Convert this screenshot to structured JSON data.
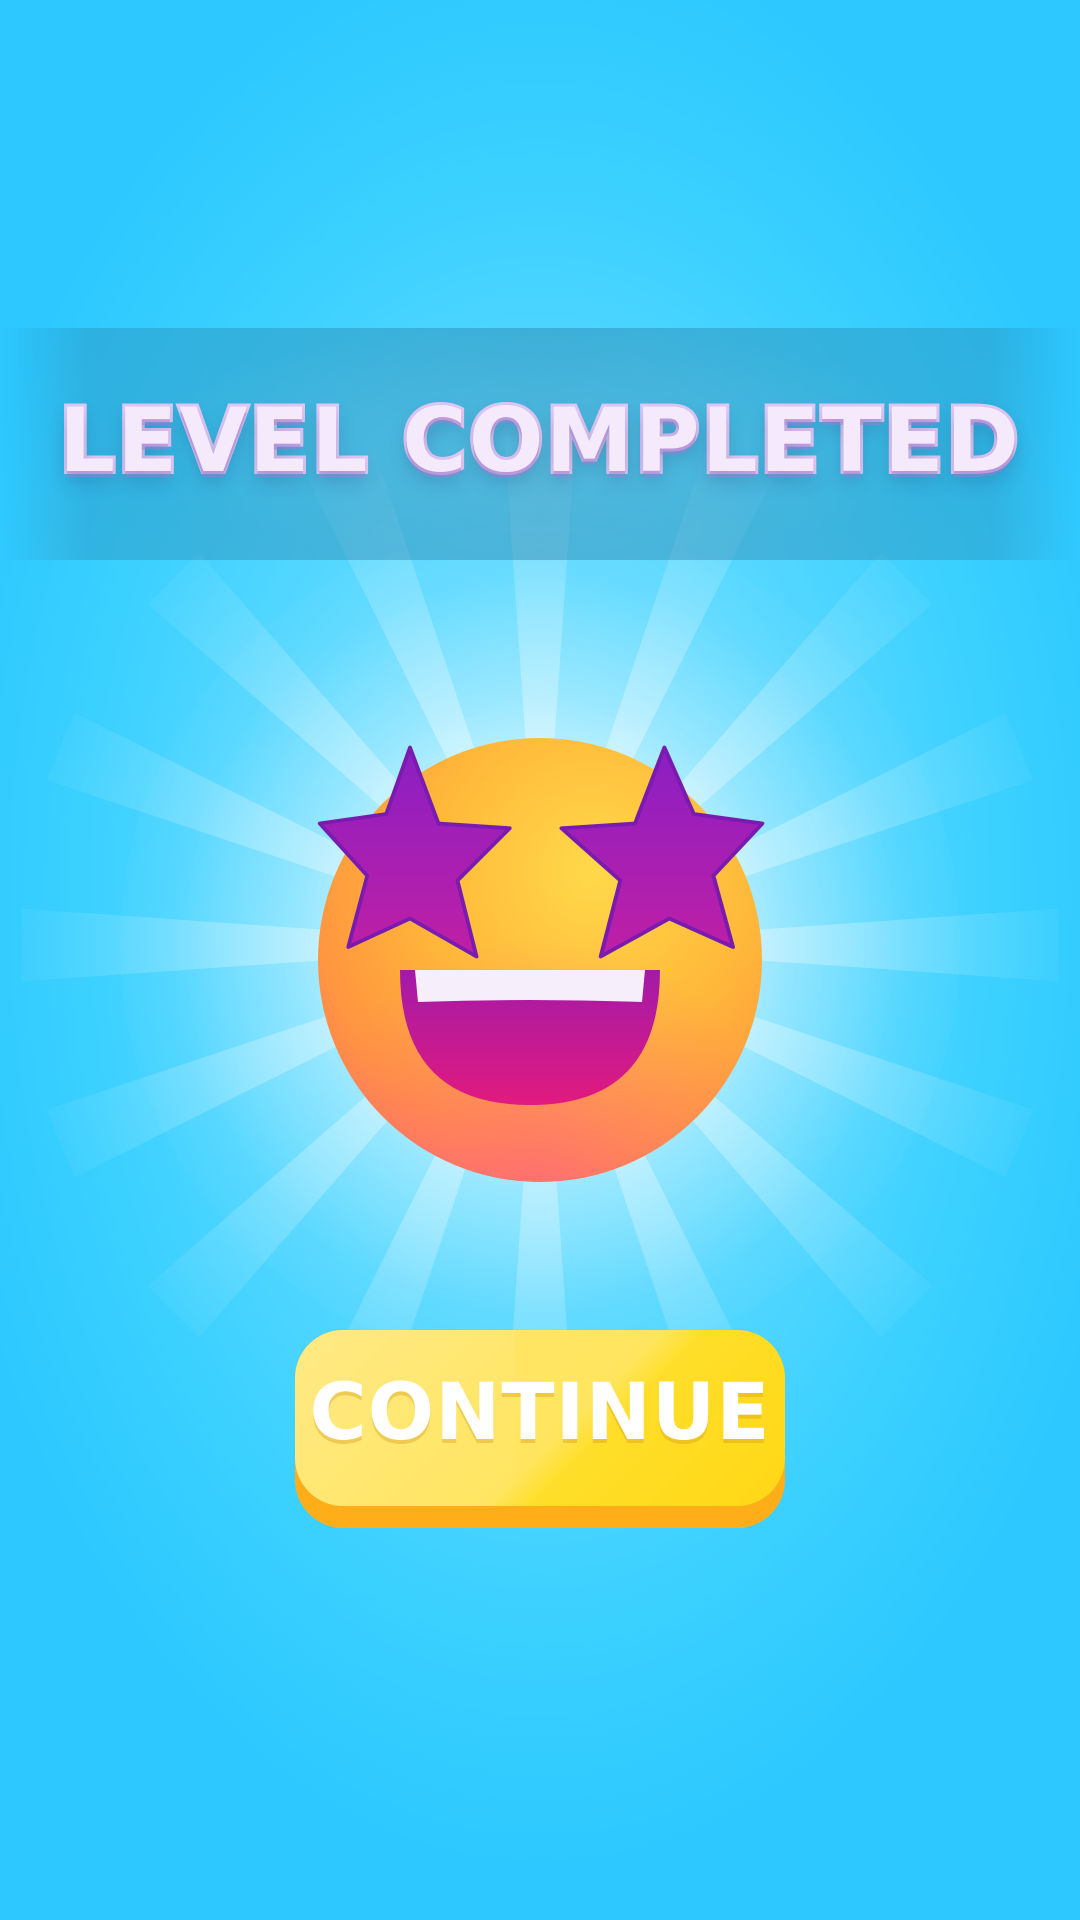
{
  "screen": {
    "title": "LEVEL COMPLETED",
    "emoji_icon": "star-struck-face",
    "continue_label": "CONTINUE"
  },
  "colors": {
    "background": "#3ad0ff",
    "title_fill": "#f4eafc",
    "title_outline": "#e2c8f5",
    "button_face": "#ffe55f",
    "button_edge": "#ffae1a",
    "emoji_face": "#ffb73a",
    "star_eyes": "#9b23c2",
    "mouth": "#c8148c"
  }
}
